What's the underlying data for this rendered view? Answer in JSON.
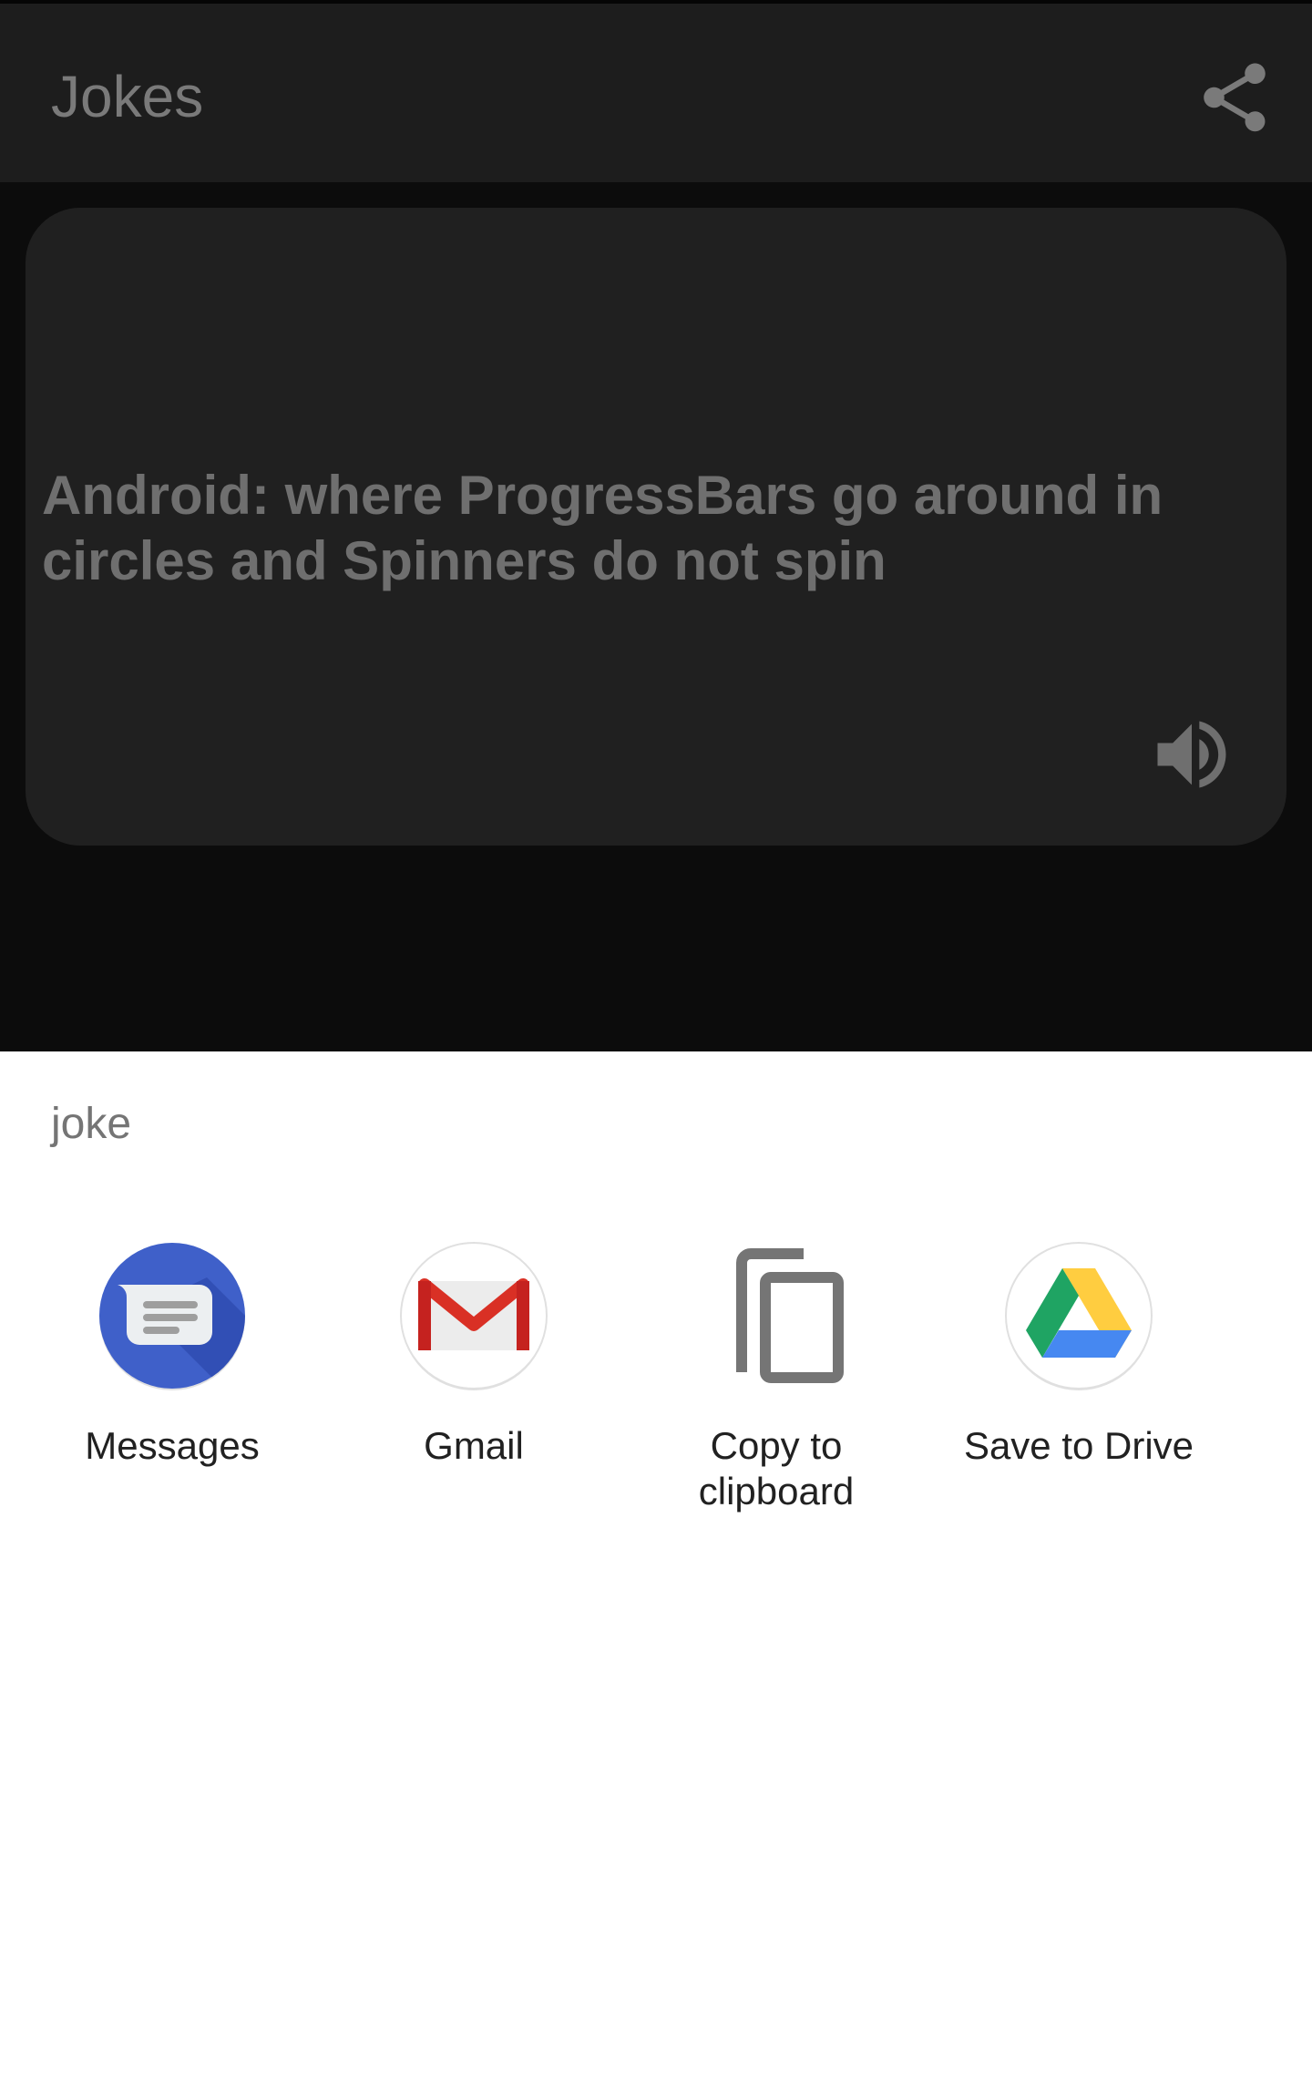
{
  "app_bar": {
    "title": "Jokes",
    "share_icon": "share-icon"
  },
  "joke": {
    "text": "Android: where ProgressBars go around in circles and Spinners do not spin",
    "speaker_icon": "speaker-icon"
  },
  "share_sheet": {
    "title": "joke",
    "targets": [
      {
        "label": "Messages",
        "icon": "messages-icon",
        "color": "#3b5fd0"
      },
      {
        "label": "Gmail",
        "icon": "gmail-icon",
        "color": "#d93025"
      },
      {
        "label": "Copy to\nclipboard",
        "icon": "copy-icon",
        "color": "#757575"
      },
      {
        "label": "Save to Drive",
        "icon": "drive-icon",
        "color": "#1fa463"
      }
    ]
  },
  "colors": {
    "scrim_app_bar": "#1d1d1d",
    "scrim_background": "#0c0c0c",
    "card": "#202020",
    "sheet_background": "#ffffff"
  }
}
